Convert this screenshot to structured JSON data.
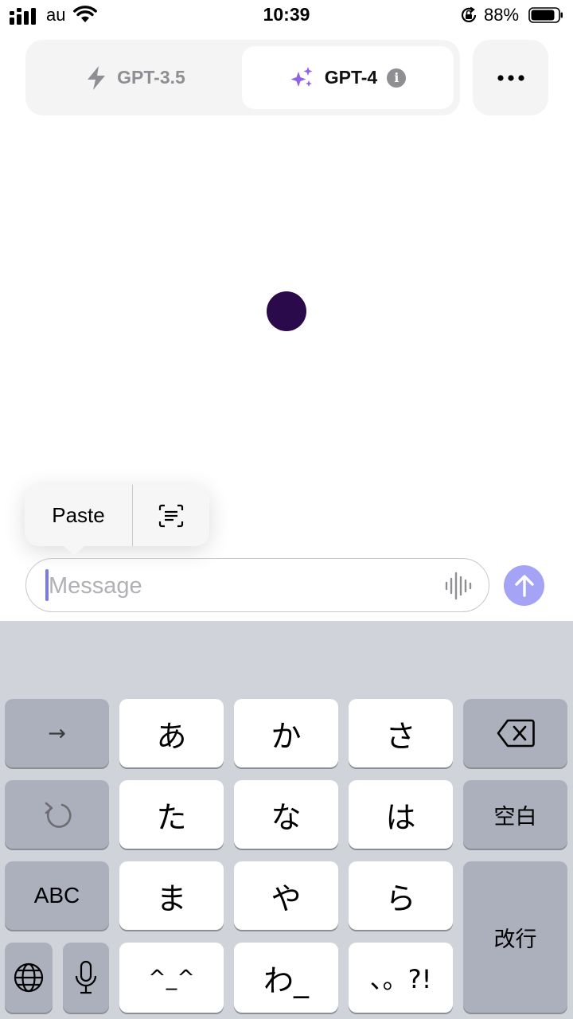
{
  "status_bar": {
    "carrier": "au",
    "time": "10:39",
    "battery_percent": "88%",
    "battery_level": 0.88
  },
  "model_switcher": {
    "tabs": [
      {
        "label": "GPT-3.5",
        "icon": "lightning-icon",
        "selected": false
      },
      {
        "label": "GPT-4",
        "icon": "sparkles-icon",
        "selected": true
      }
    ],
    "info_badge": "i",
    "accent_color": "#8f63e8"
  },
  "context_menu": {
    "paste_label": "Paste",
    "scan_icon": "scan-text-icon"
  },
  "composer": {
    "placeholder": "Message",
    "value": "",
    "voice_icon": "waveform-icon",
    "send_color": "#a4a3f5"
  },
  "keyboard": {
    "rows": [
      [
        "→",
        "あ",
        "か",
        "さ",
        "delete"
      ],
      [
        "undo",
        "た",
        "な",
        "は",
        "空白"
      ],
      [
        "ABC",
        "ま",
        "や",
        "ら",
        "改行"
      ],
      [
        "globe",
        "mic",
        "^_^",
        "わ_",
        "、。?!"
      ]
    ],
    "labels": {
      "arrow": "→",
      "a": "あ",
      "ka": "か",
      "sa": "さ",
      "ta": "た",
      "na": "な",
      "ha": "は",
      "space": "空白",
      "abc": "ABC",
      "ma": "ま",
      "ya": "や",
      "ra": "ら",
      "return": "改行",
      "kaomoji": "^_^",
      "wa": "わ_",
      "punct": "、。?!"
    }
  }
}
